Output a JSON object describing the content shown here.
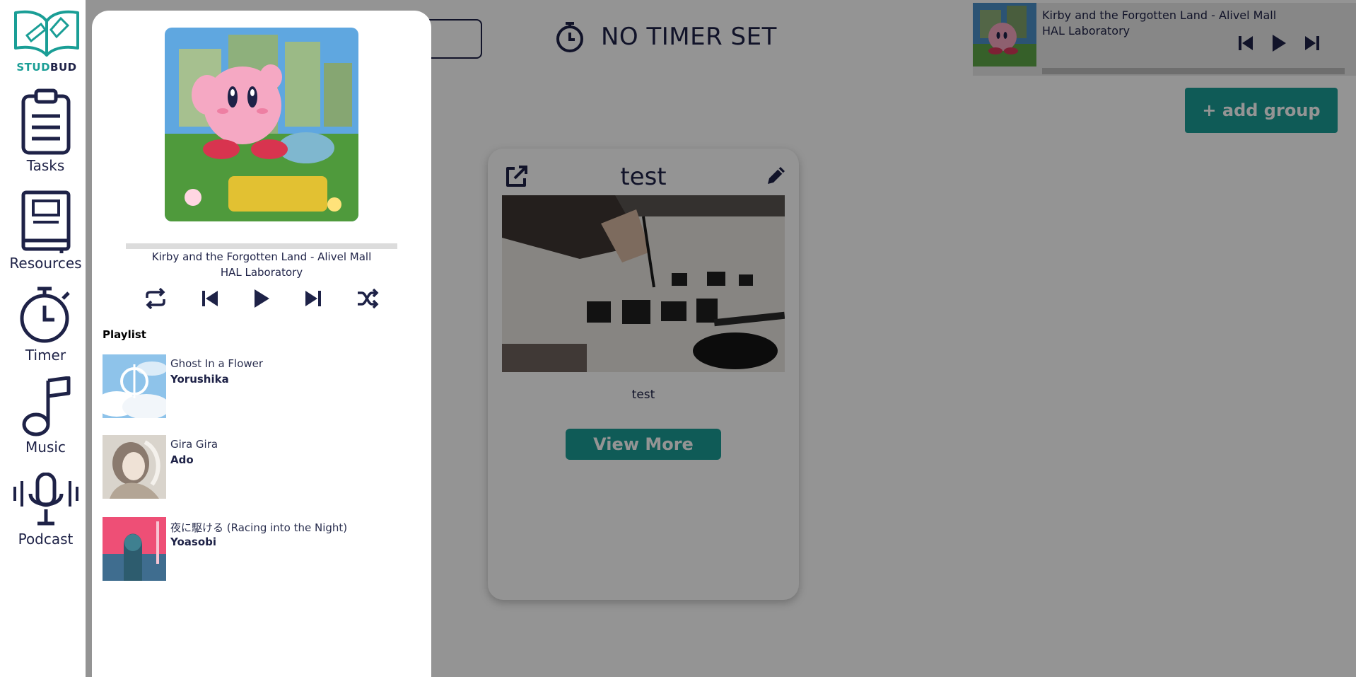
{
  "app": {
    "brand_part1": "STUD",
    "brand_part2": "BUD"
  },
  "sidebar": {
    "items": [
      {
        "label": "Tasks",
        "icon": "clipboard-icon"
      },
      {
        "label": "Resources",
        "icon": "book-icon"
      },
      {
        "label": "Timer",
        "icon": "stopwatch-icon"
      },
      {
        "label": "Music",
        "icon": "music-note-icon"
      },
      {
        "label": "Podcast",
        "icon": "microphone-icon"
      }
    ]
  },
  "header": {
    "timer_text": "NO TIMER SET"
  },
  "mini_player": {
    "title": "Kirby and the Forgotten Land - Alivel Mall",
    "artist": "HAL Laboratory"
  },
  "toolbar": {
    "add_group_label": "+ add group"
  },
  "group_card": {
    "title": "test",
    "description": "test",
    "view_more_label": "View More"
  },
  "music_panel": {
    "now_playing": {
      "title": "Kirby and the Forgotten Land - Alivel Mall",
      "artist": "HAL Laboratory",
      "progress": 0
    },
    "playlist_heading": "Playlist",
    "playlist": [
      {
        "title": "Ghost In a Flower",
        "artist": "Yorushika"
      },
      {
        "title": "Gira Gira",
        "artist": "Ado"
      },
      {
        "title": "夜に駆ける (Racing into the Night)",
        "artist": "Yoasobi"
      }
    ]
  },
  "colors": {
    "brand_teal": "#1a9e96",
    "navy": "#1e2247",
    "overlay": "rgba(0,0,0,0.42)"
  }
}
